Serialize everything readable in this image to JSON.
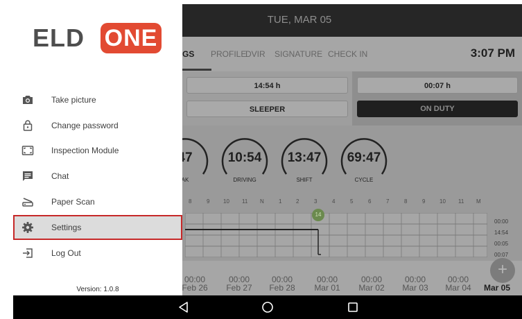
{
  "topbar": {
    "date": "TUE, MAR 05",
    "night_mode_icon": "moon-icon"
  },
  "tabs": [
    {
      "label": "GS",
      "active": true
    },
    {
      "label": "PROFILE"
    },
    {
      "label": "DVIR"
    },
    {
      "label": "SIGNATURE"
    },
    {
      "label": "CHECK IN"
    }
  ],
  "clock": "3:07 PM",
  "status": {
    "left_time": "14:54 h",
    "left_status": "SLEEPER",
    "right_time": "00:07 h",
    "right_status": "ON DUTY"
  },
  "gauges": [
    {
      "value": "47",
      "label": "AK"
    },
    {
      "value": "10:54",
      "label": "DRIVING"
    },
    {
      "value": "13:47",
      "label": "SHIFT"
    },
    {
      "value": "69:47",
      "label": "CYCLE"
    }
  ],
  "log": {
    "hours": [
      "8",
      "9",
      "10",
      "11",
      "N",
      "1",
      "2",
      "3",
      "4",
      "5",
      "6",
      "7",
      "8",
      "9",
      "10",
      "11",
      "M"
    ],
    "marker": "14",
    "totals": [
      "00:00",
      "14:54",
      "00:05",
      "00:07"
    ]
  },
  "dates": [
    {
      "time": "00:00",
      "date": "Feb 26"
    },
    {
      "time": "00:00",
      "date": "Feb 27"
    },
    {
      "time": "00:00",
      "date": "Feb 28"
    },
    {
      "time": "00:00",
      "date": "Mar 01"
    },
    {
      "time": "00:00",
      "date": "Mar 02"
    },
    {
      "time": "00:00",
      "date": "Mar 03"
    },
    {
      "time": "00:00",
      "date": "Mar 04"
    },
    {
      "time": "",
      "date": "Mar 05",
      "active": true
    }
  ],
  "fab_label": "+",
  "drawer": {
    "logo_left": "ELD",
    "logo_right": "ONE",
    "items": [
      {
        "label": "Take picture",
        "icon": "camera-icon"
      },
      {
        "label": "Change password",
        "icon": "lock-icon"
      },
      {
        "label": "Inspection Module",
        "icon": "inspection-icon"
      },
      {
        "label": "Chat",
        "icon": "chat-icon"
      },
      {
        "label": "Paper Scan",
        "icon": "scanner-icon"
      },
      {
        "label": "Settings",
        "icon": "gear-icon",
        "selected": true
      },
      {
        "label": "Log Out",
        "icon": "logout-icon"
      }
    ],
    "version": "Version: 1.0.8"
  },
  "colors": {
    "brand_red": "#e24a32",
    "selection_border": "#c62828"
  }
}
